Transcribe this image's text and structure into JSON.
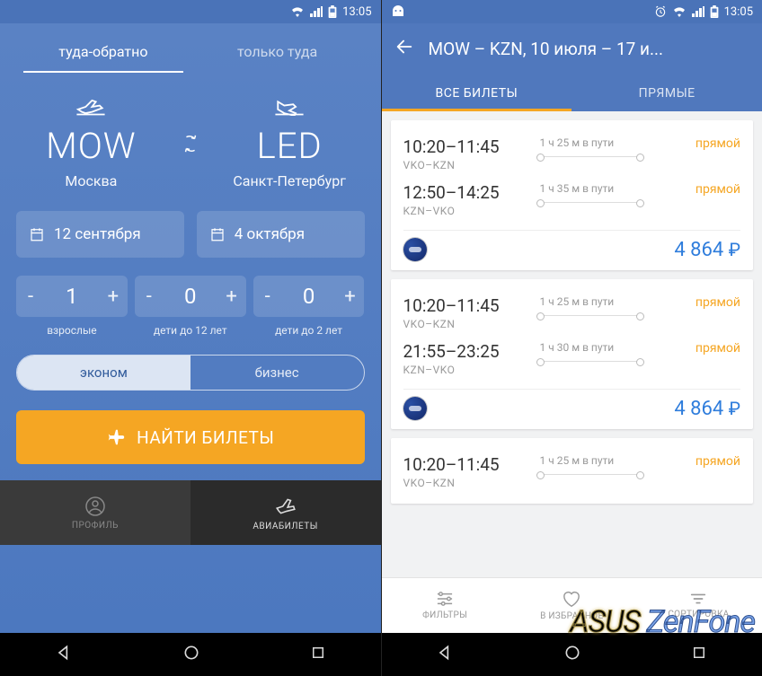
{
  "statusbar": {
    "time": "13:05"
  },
  "left": {
    "tabs": {
      "roundtrip": "туда-обратно",
      "oneway": "только туда"
    },
    "from": {
      "code": "MOW",
      "city": "Москва"
    },
    "to": {
      "code": "LED",
      "city": "Санкт-Петербург"
    },
    "dates": {
      "depart": "12 сентября",
      "return": "4 октября"
    },
    "pax": {
      "adults": {
        "value": "1",
        "label": "взрослые"
      },
      "children": {
        "value": "0",
        "label": "дети до 12 лет"
      },
      "infants": {
        "value": "0",
        "label": "дети до 2 лет"
      }
    },
    "class": {
      "economy": "эконом",
      "business": "бизнес"
    },
    "search_btn": "НАЙТИ БИЛЕТЫ",
    "nav": {
      "profile": "ПРОФИЛЬ",
      "tickets": "АВИАБИЛЕТЫ"
    }
  },
  "right": {
    "title": "MOW – KZN, 10 июля – 17 и...",
    "tabs": {
      "all": "ВСЕ БИЛЕТЫ",
      "direct": "ПРЯМЫЕ"
    },
    "cards": [
      {
        "legs": [
          {
            "time": "10:20–11:45",
            "route": "VKO–KZN",
            "duration": "1 ч 25 м в пути",
            "tag": "прямой"
          },
          {
            "time": "12:50–14:25",
            "route": "KZN–VKO",
            "duration": "1 ч 35 м в пути",
            "tag": "прямой"
          }
        ],
        "price": "4 864"
      },
      {
        "legs": [
          {
            "time": "10:20–11:45",
            "route": "VKO–KZN",
            "duration": "1 ч 25 м в пути",
            "tag": "прямой"
          },
          {
            "time": "21:55–23:25",
            "route": "KZN–VKO",
            "duration": "1 ч 30 м в пути",
            "tag": "прямой"
          }
        ],
        "price": "4 864"
      }
    ],
    "peek": {
      "time": "10:20–11:45",
      "route": "VKO–KZN",
      "duration": "1 ч 25 м в пути",
      "tag": "прямой"
    },
    "bottom": {
      "filters": "ФИЛЬТРЫ",
      "fav": "В ИЗБРАННОЕ",
      "sort": "СОРТИРОВКА"
    }
  },
  "watermark": {
    "a": "ASUS ",
    "b": "ZenFone"
  }
}
